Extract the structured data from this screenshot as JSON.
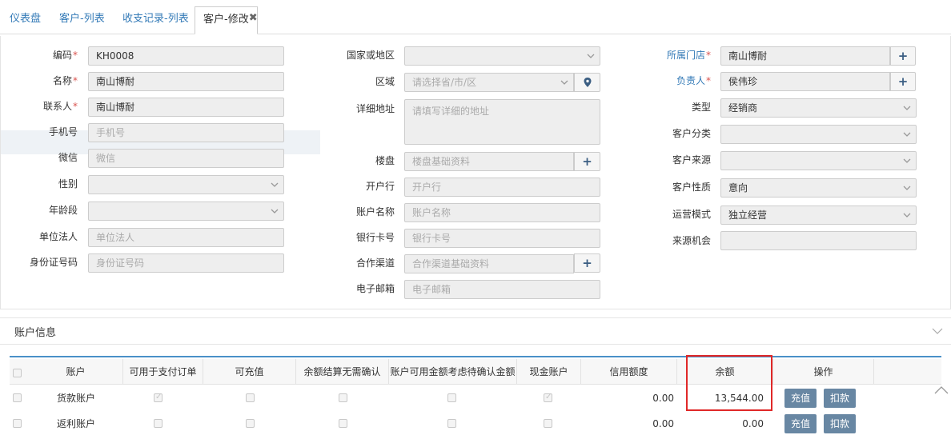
{
  "tabs": [
    {
      "label": "仪表盘"
    },
    {
      "label": "客户-列表"
    },
    {
      "label": "收支记录-列表"
    },
    {
      "label": "客户-修改"
    }
  ],
  "close_glyph": "✖",
  "form": {
    "col1": {
      "code": {
        "label": "编码",
        "value": "KH0008"
      },
      "name": {
        "label": "名称",
        "value": "南山博耐"
      },
      "contact": {
        "label": "联系人",
        "value": "南山博耐"
      },
      "mobile": {
        "label": "手机号",
        "placeholder": "手机号"
      },
      "wechat": {
        "label": "微信",
        "placeholder": "微信"
      },
      "gender": {
        "label": "性别",
        "value": ""
      },
      "age_group": {
        "label": "年龄段",
        "value": ""
      },
      "legal_person": {
        "label": "单位法人",
        "placeholder": "单位法人"
      },
      "id_number": {
        "label": "身份证号码",
        "placeholder": "身份证号码"
      }
    },
    "col2": {
      "country": {
        "label": "国家或地区",
        "value": ""
      },
      "region": {
        "label": "区域",
        "placeholder": "请选择省/市/区"
      },
      "address": {
        "label": "详细地址",
        "placeholder": "请填写详细的地址"
      },
      "building": {
        "label": "楼盘",
        "placeholder": "楼盘基础资料"
      },
      "bank": {
        "label": "开户行",
        "placeholder": "开户行"
      },
      "account_name": {
        "label": "账户名称",
        "placeholder": "账户名称"
      },
      "bank_card": {
        "label": "银行卡号",
        "placeholder": "银行卡号"
      },
      "channel": {
        "label": "合作渠道",
        "placeholder": "合作渠道基础资料"
      },
      "email": {
        "label": "电子邮箱",
        "placeholder": "电子邮箱"
      }
    },
    "col3": {
      "store": {
        "label": "所属门店",
        "value": "南山博耐"
      },
      "owner": {
        "label": "负责人",
        "value": "侯伟珍"
      },
      "type": {
        "label": "类型",
        "value": "经销商"
      },
      "category": {
        "label": "客户分类",
        "value": ""
      },
      "source": {
        "label": "客户来源",
        "value": ""
      },
      "nature": {
        "label": "客户性质",
        "value": "意向"
      },
      "mode": {
        "label": "运营模式",
        "value": "独立经营"
      },
      "opportunity": {
        "label": "来源机会",
        "value": ""
      }
    },
    "required_mark": "*",
    "add_glyph": "+"
  },
  "account_section": {
    "title": "账户信息",
    "columns": [
      "账户",
      "可用于支付订单",
      "可充值",
      "余额结算无需确认",
      "账户可用金额考虑待确认金额",
      "现金账户",
      "信用额度",
      "余额",
      "操作"
    ],
    "rows": [
      {
        "name": "货款账户",
        "credit": "0.00",
        "balance": "13,544.00",
        "actions": [
          "充值",
          "扣款"
        ]
      },
      {
        "name": "返利账户",
        "credit": "0.00",
        "balance": "0.00",
        "actions": [
          "充值",
          "扣款"
        ]
      }
    ]
  },
  "colors": {
    "accent": "#4a90c8",
    "button": "#6887a3",
    "required": "#d9534f",
    "highlight_box": "#e02828"
  }
}
